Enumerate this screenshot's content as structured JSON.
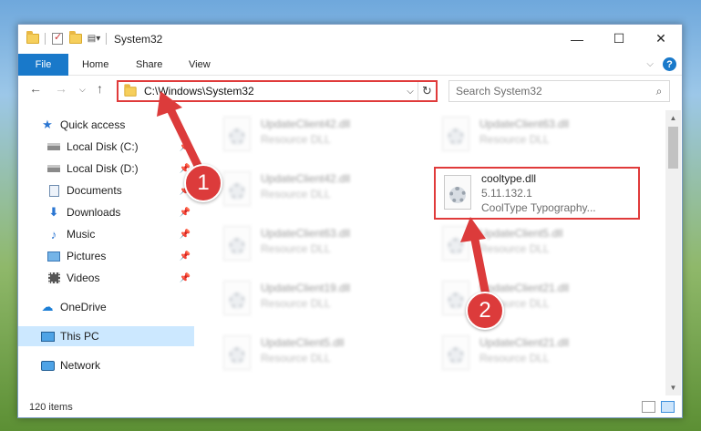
{
  "window": {
    "title": "System32",
    "controls": {
      "minimize": "—",
      "maximize": "☐",
      "close": "✕"
    }
  },
  "ribbon": {
    "tabs": [
      "File",
      "Home",
      "Share",
      "View"
    ],
    "help": "?"
  },
  "address": {
    "path": "C:\\Windows\\System32",
    "dropdown": "⌵",
    "refresh": "↻"
  },
  "search": {
    "placeholder": "Search System32",
    "icon": "search-icon"
  },
  "nav": {
    "quick_access": "Quick access",
    "items": [
      {
        "label": "Local Disk (C:)",
        "icon": "drive-icon",
        "pinned": true
      },
      {
        "label": "Local Disk (D:)",
        "icon": "drive-icon",
        "pinned": true
      },
      {
        "label": "Documents",
        "icon": "documents-icon",
        "pinned": true
      },
      {
        "label": "Downloads",
        "icon": "downloads-icon",
        "pinned": true
      },
      {
        "label": "Music",
        "icon": "music-icon",
        "pinned": true
      },
      {
        "label": "Pictures",
        "icon": "pictures-icon",
        "pinned": true
      },
      {
        "label": "Videos",
        "icon": "videos-icon",
        "pinned": true
      }
    ],
    "onedrive": "OneDrive",
    "this_pc": "This PC",
    "network": "Network"
  },
  "files": {
    "left": [
      {
        "name": "UpdateClient42.dll",
        "type": "Resource DLL"
      },
      {
        "name": "UpdateClient42.dll",
        "type": "Resource DLL"
      },
      {
        "name": "UpdateClient63.dll",
        "type": "Resource DLL"
      },
      {
        "name": "UpdateClient19.dll",
        "type": "Resource DLL"
      },
      {
        "name": "UpdateClient5.dll",
        "type": "Resource DLL"
      }
    ],
    "right": [
      {
        "name": "UpdateClient63.dll",
        "type": "Resource DLL"
      },
      {
        "name": "UpdateClient5.dll",
        "type": "Resource DLL"
      },
      {
        "name": "UpdateClient21.dll",
        "type": "Resource DLL"
      },
      {
        "name": "UpdateClient21.dll",
        "type": "Resource DLL"
      }
    ],
    "highlighted": {
      "name": "cooltype.dll",
      "version": "5.11.132.1",
      "description": "CoolType Typography..."
    }
  },
  "status": {
    "items": "120 items"
  },
  "annotations": {
    "step1": "1",
    "step2": "2",
    "color": "#dc3b3b"
  }
}
